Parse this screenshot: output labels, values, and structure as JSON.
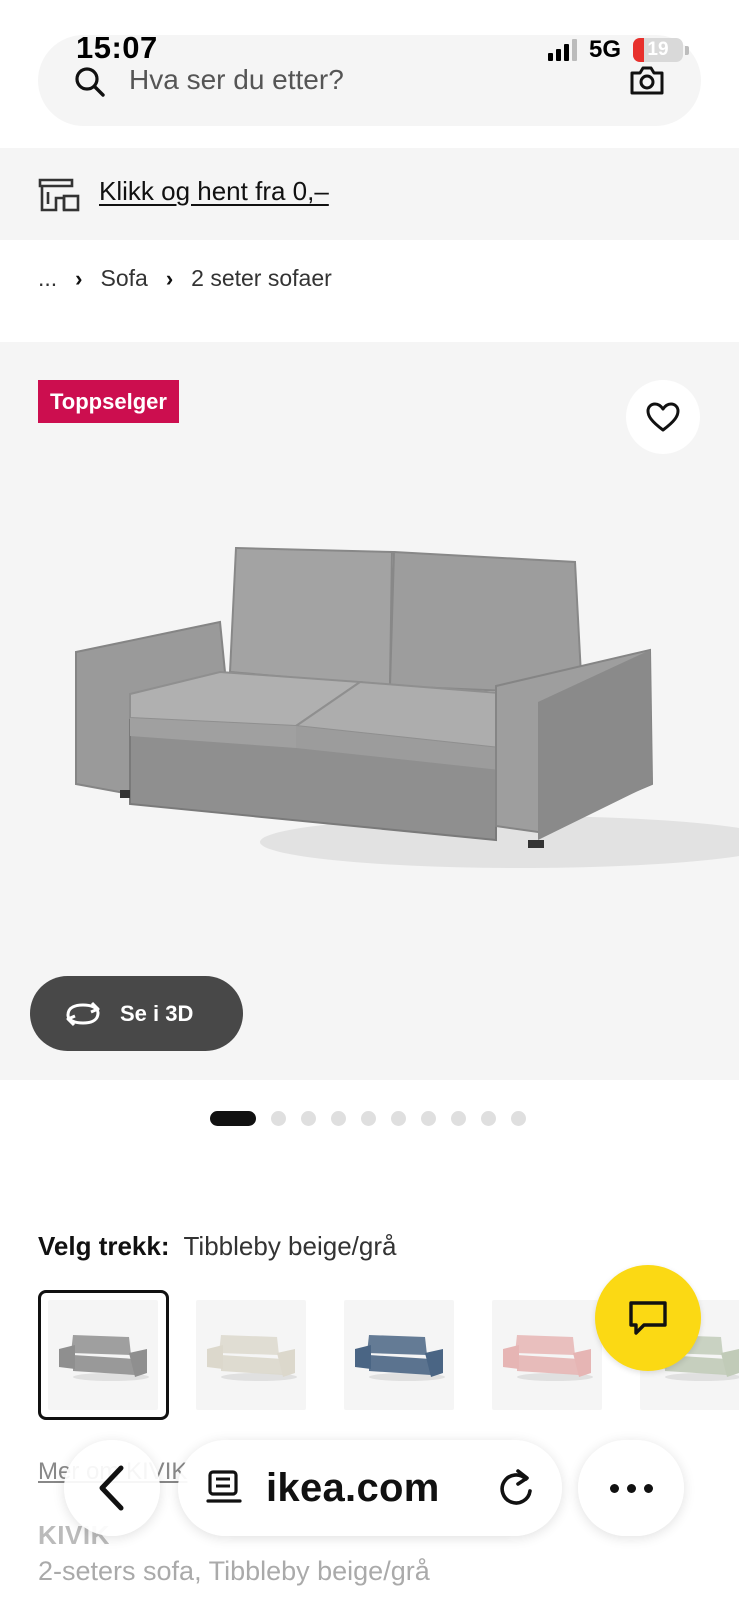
{
  "status_bar": {
    "time": "15:07",
    "network": "5G",
    "battery": "19"
  },
  "search": {
    "placeholder": "Hva ser du etter?",
    "icon": "search-icon",
    "camera_icon": "camera-icon"
  },
  "banner": {
    "link": "Klikk og hent fra 0,–",
    "icon": "store-pickup-icon"
  },
  "breadcrumb": {
    "ellipsis": "...",
    "items": [
      "Sofa",
      "2 seter sofaer"
    ]
  },
  "product_image": {
    "badge": "Toppselger",
    "button_3d": "Se i 3D",
    "favorite_icon": "heart-icon",
    "image_index": 1,
    "image_count": 10
  },
  "cover": {
    "label": "Velg trekk:",
    "selected": "Tibbleby beige/grå",
    "swatch_colors": [
      "#8f8f8f",
      "#dcd8cc",
      "#4a6584",
      "#e6b5b4",
      "#c1cbb8"
    ]
  },
  "product": {
    "partial_link": "Mer om KIVIK",
    "name": "KIVIK",
    "description": "2-seters sofa, Tibbleby beige/grå"
  },
  "browser": {
    "url": "ikea.com",
    "back_icon": "chevron-left-icon",
    "reader_icon": "reader-icon",
    "reload_icon": "reload-icon",
    "more_icon": "more-icon"
  },
  "colors": {
    "badge": "#cc0e4f",
    "chat": "#fbd914",
    "button_3d": "#484848"
  }
}
